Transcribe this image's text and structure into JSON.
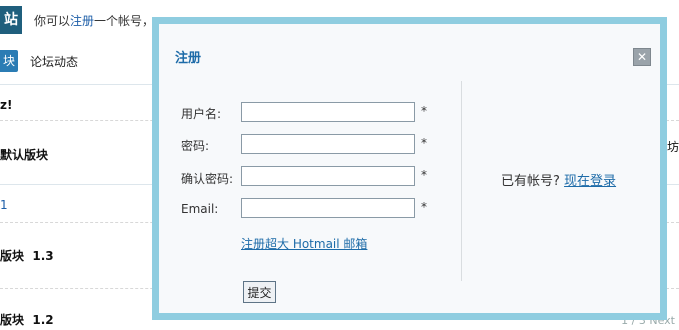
{
  "background": {
    "logo_char": "站",
    "top_text_prefix": "你可以",
    "top_link_register": "注册",
    "top_text_suffix": "一个帐号，",
    "tab_active": "块",
    "tab_forum_activity": "论坛动态",
    "section_title": "z!",
    "category_default": "默认版块",
    "row_link_1": "1",
    "board_1": "版块",
    "board_1_version": "1.3",
    "board_2": "版块",
    "board_2_version": "1.2",
    "right_edge_1": "坊",
    "footer_text": "1 / 3    Next"
  },
  "modal": {
    "title": "注册",
    "close_symbol": "✕",
    "fields": [
      {
        "label": "用户名:",
        "value": "",
        "required_mark": "*"
      },
      {
        "label": "密码:",
        "value": "",
        "required_mark": "*"
      },
      {
        "label": "确认密码:",
        "value": "",
        "required_mark": "*"
      },
      {
        "label": "Email:",
        "value": "",
        "required_mark": "*"
      }
    ],
    "hotmail_link": "注册超大 Hotmail 邮箱",
    "submit_label": "提交",
    "have_account_text": "已有帐号?",
    "login_link": "现在登录"
  },
  "colors": {
    "modal_border": "#8fcde0",
    "link": "#1d6ba8",
    "title": "#1d6ba8"
  }
}
